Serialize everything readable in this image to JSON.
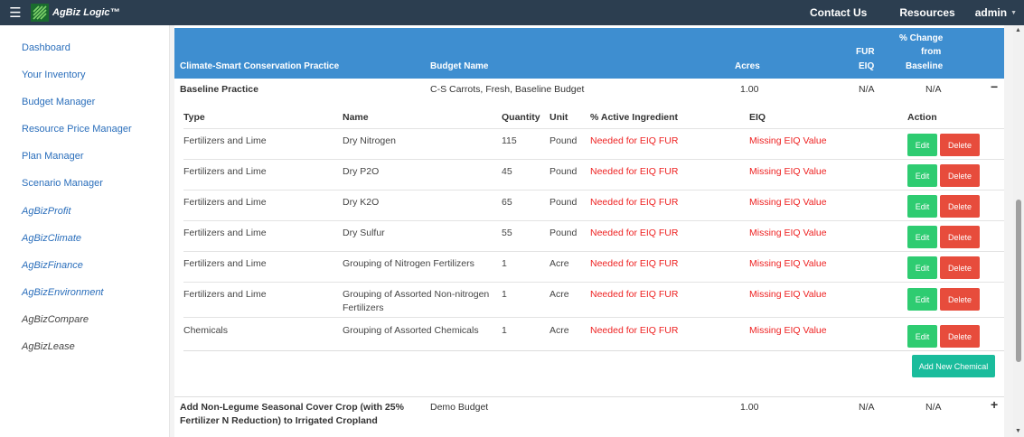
{
  "navbar": {
    "menu_icon": "hamburger-icon",
    "brand": "AgBiz Logic™",
    "links": [
      "Contact Us",
      "Resources"
    ],
    "user": "admin"
  },
  "sidebar": {
    "items": [
      "Dashboard",
      "Your Inventory",
      "Budget Manager",
      "Resource Price Manager",
      "Plan Manager",
      "Scenario Manager",
      "AgBizProfit",
      "AgBizClimate",
      "AgBizFinance",
      "AgBizEnvironment",
      "AgBizCompare",
      "AgBizLease"
    ]
  },
  "table": {
    "headers": {
      "practice": "Climate-Smart Conservation Practice",
      "budget": "Budget Name",
      "acres": "Acres",
      "fur_line1": "FUR",
      "fur_line2": "EIQ",
      "change_line1": "% Change",
      "change_line2": "from",
      "change_line3": "Baseline"
    },
    "baseline": {
      "practice": "Baseline Practice",
      "budget": "C-S Carrots, Fresh, Baseline Budget",
      "acres": "1.00",
      "fur": "N/A",
      "change": "N/A",
      "toggle": "−"
    },
    "chem_headers": {
      "type": "Type",
      "name": "Name",
      "quantity": "Quantity",
      "unit": "Unit",
      "active": "% Active Ingredient",
      "eiq": "EIQ",
      "action": "Action"
    },
    "chemicals": [
      {
        "type": "Fertilizers and Lime",
        "name": "Dry Nitrogen",
        "name2": "",
        "quantity": "115",
        "unit": "Pound",
        "active": "Needed for EIQ FUR",
        "eiq": "Missing EIQ Value",
        "edit": "Edit",
        "delete": "Delete"
      },
      {
        "type": "Fertilizers and Lime",
        "name": "Dry P2O",
        "name2": "",
        "quantity": "45",
        "unit": "Pound",
        "active": "Needed for EIQ FUR",
        "eiq": "Missing EIQ Value",
        "edit": "Edit",
        "delete": "Delete"
      },
      {
        "type": "Fertilizers and Lime",
        "name": "Dry K2O",
        "name2": "",
        "quantity": "65",
        "unit": "Pound",
        "active": "Needed for EIQ FUR",
        "eiq": "Missing EIQ Value",
        "edit": "Edit",
        "delete": "Delete"
      },
      {
        "type": "Fertilizers and Lime",
        "name": "Dry Sulfur",
        "name2": "",
        "quantity": "55",
        "unit": "Pound",
        "active": "Needed for EIQ FUR",
        "eiq": "Missing EIQ Value",
        "edit": "Edit",
        "delete": "Delete"
      },
      {
        "type": "Fertilizers and Lime",
        "name": "Grouping of Nitrogen Fertilizers",
        "name2": "",
        "quantity": "1",
        "unit": "Acre",
        "active": "Needed for EIQ FUR",
        "eiq": "Missing EIQ Value",
        "edit": "Edit",
        "delete": "Delete"
      },
      {
        "type": "Fertilizers and Lime",
        "name": "Grouping of Assorted Non-nitrogen",
        "name2": "Fertilizers",
        "quantity": "1",
        "unit": "Acre",
        "active": "Needed for EIQ FUR",
        "eiq": "Missing EIQ Value",
        "edit": "Edit",
        "delete": "Delete"
      },
      {
        "type": "Chemicals",
        "name": "Grouping of Assorted Chemicals",
        "name2": "",
        "quantity": "1",
        "unit": "Acre",
        "active": "Needed for EIQ FUR",
        "eiq": "Missing EIQ Value",
        "edit": "Edit",
        "delete": "Delete"
      }
    ],
    "add_chemical": "Add New Chemical",
    "second_practice": {
      "practice_line1": "Add Non-Legume Seasonal Cover Crop (with 25%",
      "practice_line2": "Fertilizer N Reduction) to Irrigated Cropland",
      "budget": "Demo Budget",
      "acres": "1.00",
      "fur": "N/A",
      "change": "N/A",
      "toggle": "+"
    }
  },
  "colors": {
    "navbar": "#2c3e50",
    "table_header": "#3e8ed0",
    "link": "#2a6ebb",
    "edit": "#2ecc71",
    "delete": "#e74c3c",
    "add": "#1abc9c",
    "warning_text": "#ee2222"
  }
}
